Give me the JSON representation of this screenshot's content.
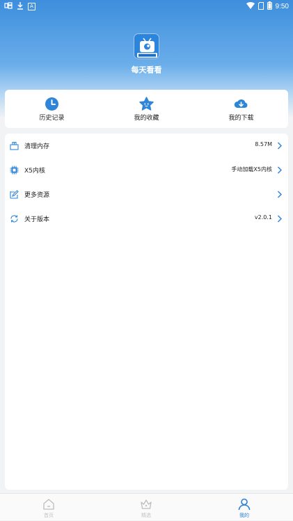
{
  "status_bar": {
    "time": "9:50",
    "left_icons": [
      "notification-icon",
      "download-icon",
      "a-icon"
    ],
    "right_icons": [
      "wifi-icon",
      "sim-icon",
      "battery-icon"
    ]
  },
  "header": {
    "app_title": "每天看看",
    "logo_text": "每天看看"
  },
  "quick_actions": [
    {
      "label": "历史记录",
      "icon": "clock-icon"
    },
    {
      "label": "我的收藏",
      "icon": "star-icon"
    },
    {
      "label": "我的下载",
      "icon": "cloud-download-icon"
    }
  ],
  "settings": [
    {
      "label": "清理内存",
      "value": "8.57M",
      "icon": "broom-icon"
    },
    {
      "label": "X5内核",
      "value": "手动加载X5内核",
      "icon": "chip-icon"
    },
    {
      "label": "更多资源",
      "value": "",
      "icon": "edit-icon"
    },
    {
      "label": "关于版本",
      "value": "v2.0.1",
      "icon": "refresh-icon"
    }
  ],
  "bottom_nav": [
    {
      "label": "首页",
      "icon": "home-icon",
      "active": false
    },
    {
      "label": "精选",
      "icon": "crown-icon",
      "active": false
    },
    {
      "label": "我的",
      "icon": "person-icon",
      "active": true
    }
  ],
  "colors": {
    "accent": "#2b7fd4",
    "header_top": "#3d8edd",
    "icon_blue": "#2f86d8"
  }
}
